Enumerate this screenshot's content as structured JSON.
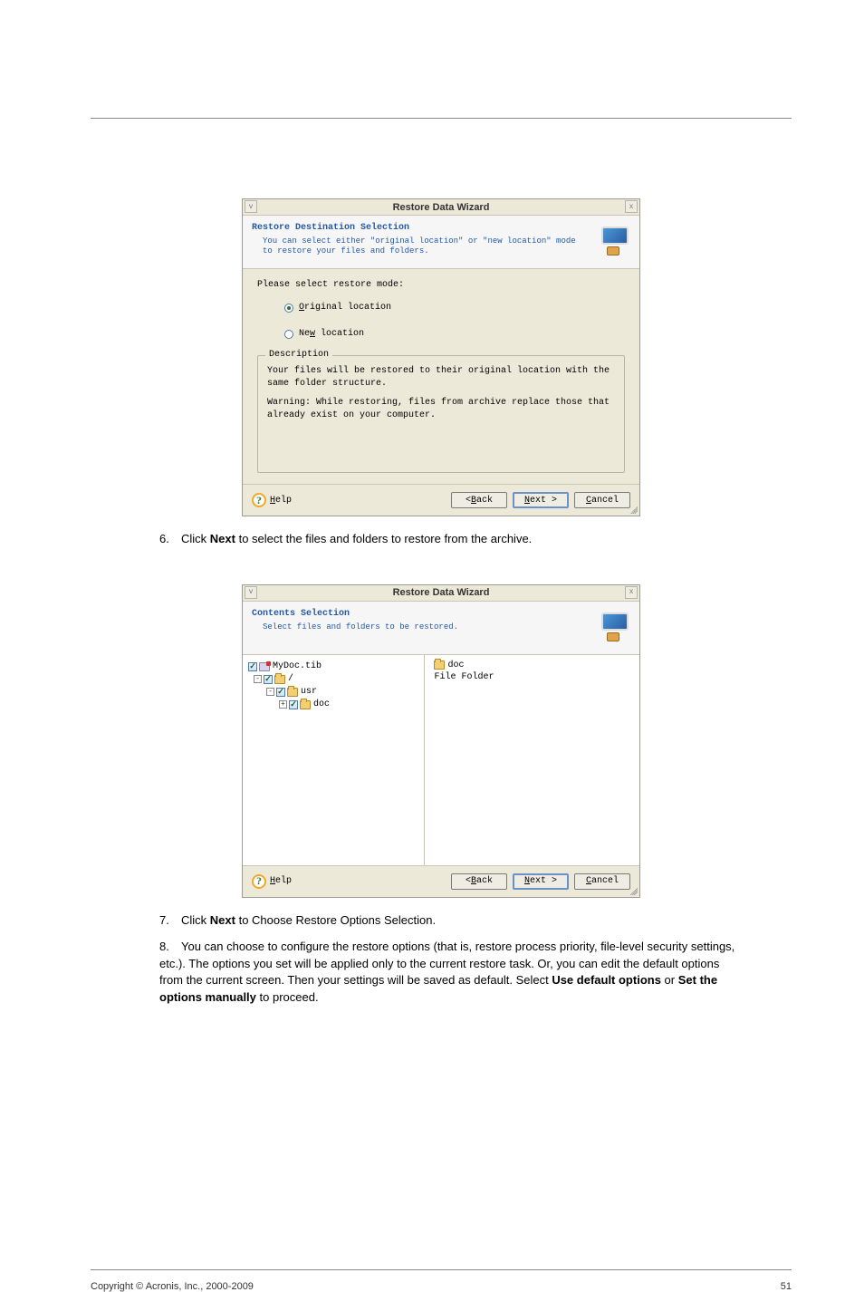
{
  "page": {
    "step6": {
      "text": "Click Next to select the files and folders to restore from the archive."
    },
    "step7": {
      "text_pre": "Click ",
      "next_word": "Next",
      "text_post": " to Choose Restore Options Selection."
    },
    "step8": {
      "t1": "You can choose to configure the restore options (that is, restore process priority, file-level security settings, etc.). The options you set will be applied only to the current restore task. Or, you can edit the default options from the current screen. Then your settings will be saved as default. Select ",
      "b1": "Use default options",
      "t2": " or ",
      "b2": "Set the options manually",
      "t3": " to proceed."
    }
  },
  "wizard": {
    "title": "Restore Data Wizard",
    "close_glyph": "x",
    "banner1": {
      "heading": "Restore Destination Selection",
      "sub": "You can select either \"original location\" or \"new location\" mode to restore your files and folders."
    },
    "modes": {
      "prompt": "Please select restore mode:",
      "opt1_pre": "O",
      "opt1_post": "riginal location",
      "opt2_pre": "Ne",
      "opt2_key": "w",
      "opt2_post": " location"
    },
    "description": {
      "legend": "Description",
      "line1": "Your files will be restored to their original location with the same folder structure.",
      "line2": "Warning: While restoring, files from archive replace those that already exist on your computer."
    },
    "buttons": {
      "help_key": "H",
      "help_rest": "elp",
      "back": "< Back",
      "back_key": "B",
      "next_key": "N",
      "next": "Next >",
      "cancel": "Cancel",
      "cancel_key": "C"
    },
    "banner2": {
      "heading": "Contents Selection",
      "sub": "Select files and folders to be restored."
    },
    "tree": {
      "root": "MyDoc.tib",
      "slash": "/",
      "usr": "usr",
      "doc": "doc"
    },
    "detail": {
      "folder": "doc",
      "type": "File Folder"
    }
  },
  "footer": {
    "left": "Copyright © Acronis, Inc., 2000-2009",
    "right": "51"
  },
  "steps": {
    "n6": "6.",
    "n7": "7.",
    "n8": "8."
  },
  "next_word": "Next"
}
